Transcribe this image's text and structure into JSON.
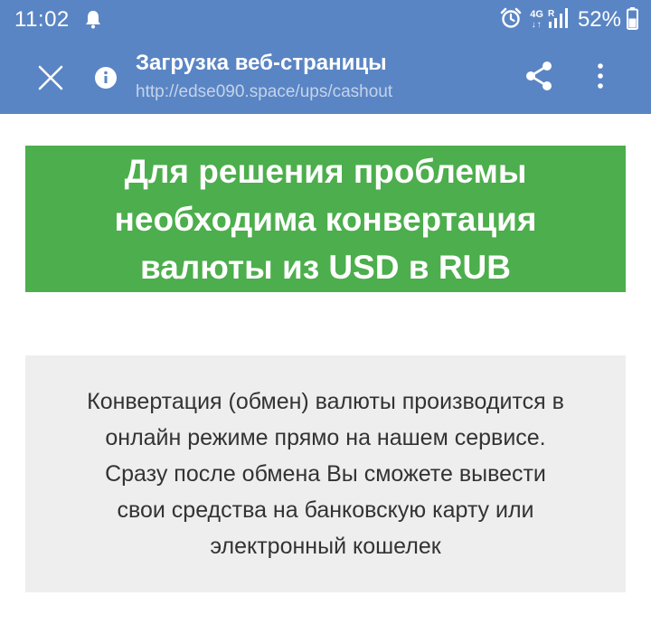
{
  "status_bar": {
    "time": "11:02",
    "network_type": "4G",
    "network_arrows": "↓↑",
    "roaming": "R",
    "battery": "52%",
    "icons": [
      "notification-bell-icon",
      "alarm-clock-icon",
      "signal-icon",
      "battery-icon"
    ]
  },
  "toolbar": {
    "title": "Загрузка веб-страницы",
    "url": "http://edse090.space/ups/cashout",
    "icons": [
      "close-icon",
      "info-icon",
      "share-icon",
      "more-vert-icon"
    ]
  },
  "content": {
    "banner_lines": [
      "Для решения проблемы",
      "необходима конвертация",
      "валюты из USD в RUB"
    ],
    "info_lines": [
      "Конвертация (обмен) валюты производится в",
      "онлайн режиме прямо на нашем сервисе.",
      "Сразу после обмена Вы сможете вывести",
      "свои средства на банковскую карту или",
      "электронный кошелек"
    ]
  },
  "colors": {
    "app_bar": "#5a85c4",
    "banner_bg": "#4cae4c",
    "info_bg": "#eeeeee",
    "text_dark": "#333333"
  }
}
